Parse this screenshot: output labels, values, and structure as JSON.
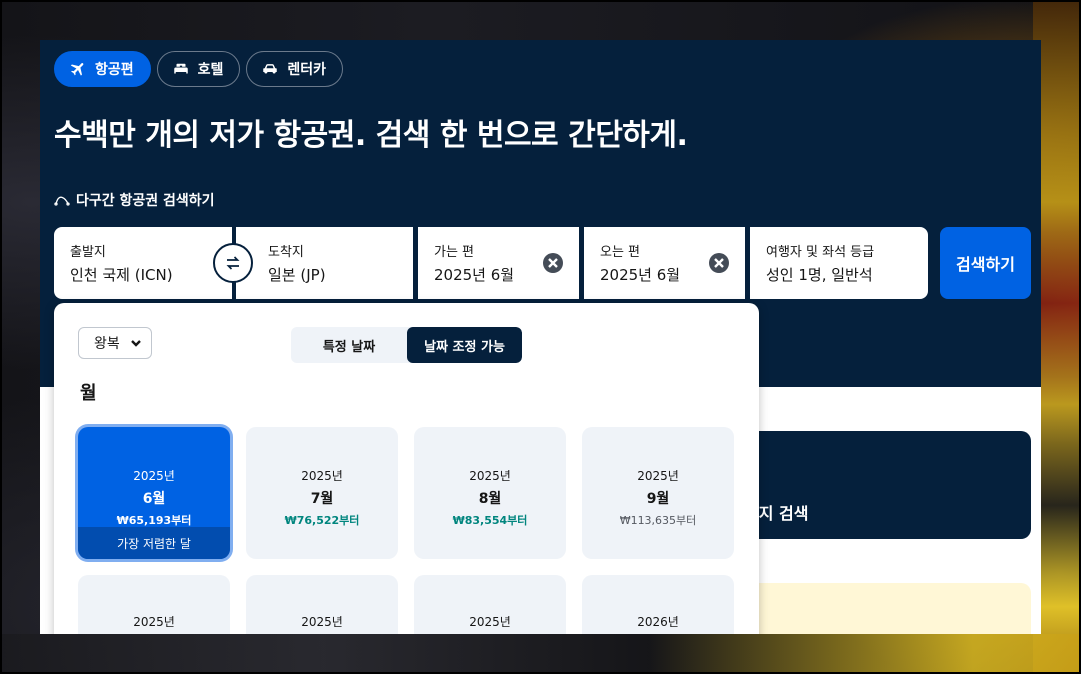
{
  "tabs": [
    {
      "label": "항공편",
      "icon": "plane-icon",
      "active": true
    },
    {
      "label": "호텔",
      "icon": "bed-icon",
      "active": false
    },
    {
      "label": "렌터카",
      "icon": "car-icon",
      "active": false
    }
  ],
  "headline": "수백만 개의 저가 항공권. 검색 한 번으로 간단하게.",
  "multi_city_label": "다구간 항공권 검색하기",
  "search": {
    "origin": {
      "label": "출발지",
      "value": "인천 국제 (ICN)"
    },
    "destination": {
      "label": "도착지",
      "value": "일본 (JP)"
    },
    "depart": {
      "label": "가는 편",
      "value": "2025년 6월"
    },
    "return": {
      "label": "오는 편",
      "value": "2025년 6월"
    },
    "travellers": {
      "label": "여행자 및 좌석 등급",
      "value": "성인 1명, 일반석"
    },
    "button": "검색하기"
  },
  "background": {
    "anywhere_label": "든지 검색"
  },
  "popover": {
    "trip_type": "왕복",
    "toggle": {
      "specific": "특정 날짜",
      "flexible": "날짜 조정 가능"
    },
    "section_title": "월",
    "months": [
      {
        "year": "2025년",
        "month": "6월",
        "price": "₩65,193부터",
        "selected": true,
        "tag": "가장 저렴한 달"
      },
      {
        "year": "2025년",
        "month": "7월",
        "price": "₩76,522부터",
        "price_style": "green"
      },
      {
        "year": "2025년",
        "month": "8월",
        "price": "₩83,554부터",
        "price_style": "green"
      },
      {
        "year": "2025년",
        "month": "9월",
        "price": "₩113,635부터",
        "price_style": "gray"
      },
      {
        "year": "2025년",
        "month": "",
        "price": ""
      },
      {
        "year": "2025년",
        "month": "",
        "price": ""
      },
      {
        "year": "2025년",
        "month": "",
        "price": ""
      },
      {
        "year": "2026년",
        "month": "",
        "price": ""
      }
    ]
  },
  "colors": {
    "navy": "#05203c",
    "primary_blue": "#0062e3",
    "price_green": "#00857e"
  }
}
